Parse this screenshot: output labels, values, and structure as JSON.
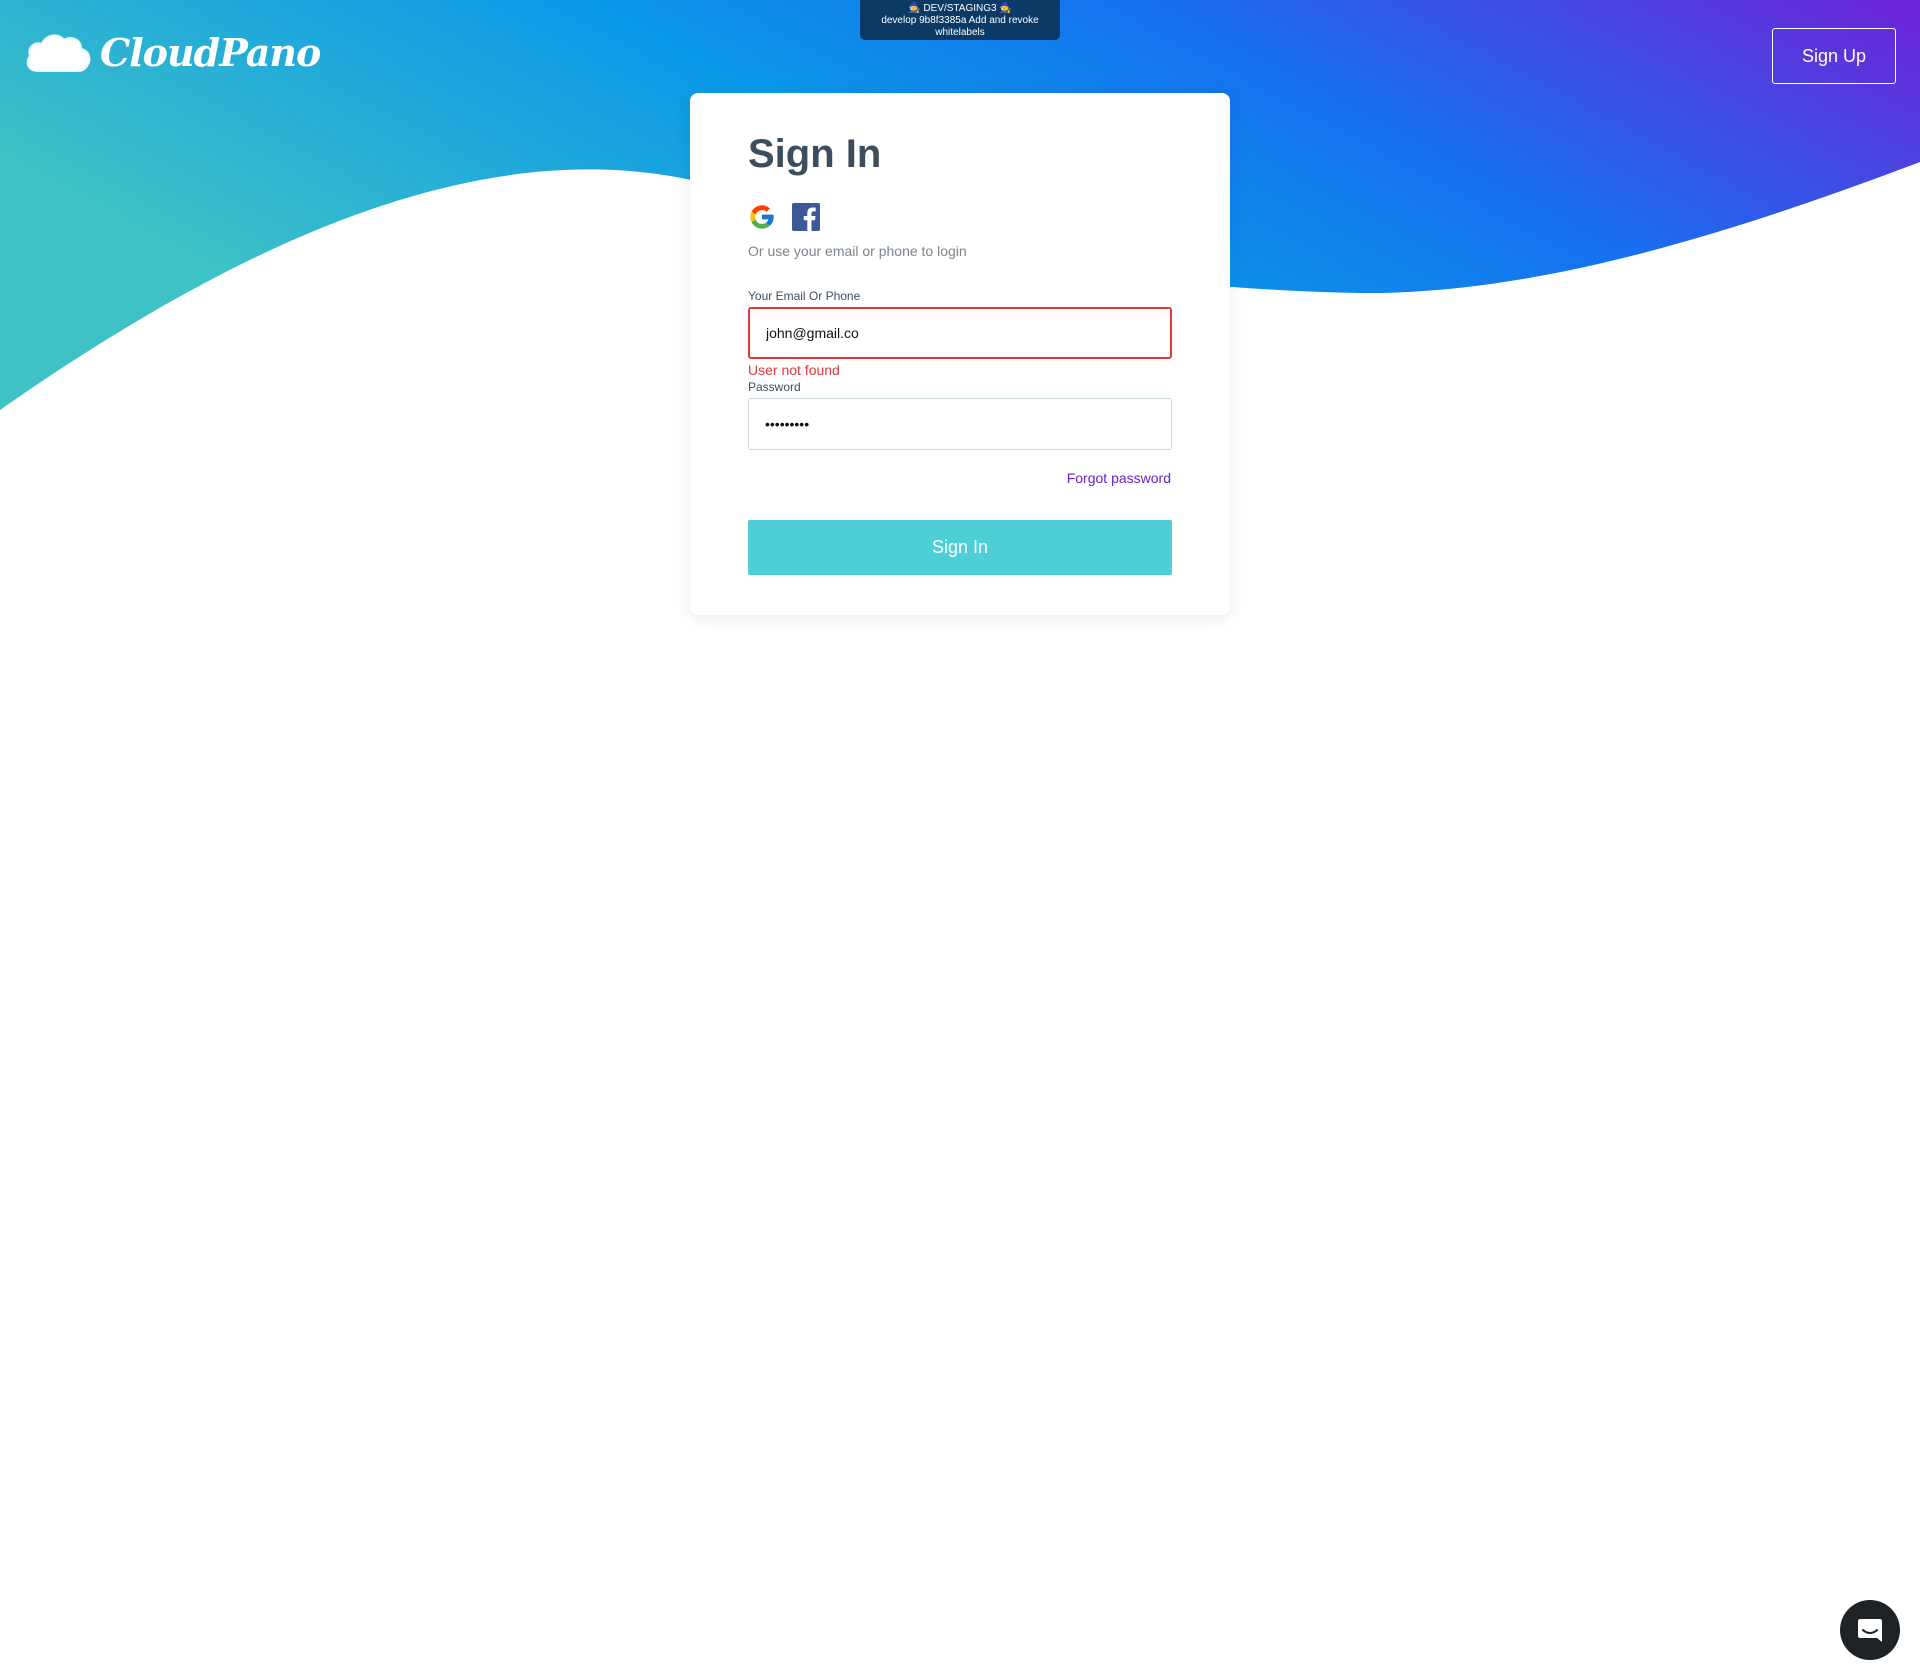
{
  "dev_banner": {
    "line1": "🧙 DEV/STAGING3 🧙",
    "line2": "develop 9b8f3385a Add and revoke",
    "line3": "whitelabels"
  },
  "header": {
    "logo_text": "CloudPano",
    "signup_label": "Sign Up"
  },
  "signin": {
    "title": "Sign In",
    "alt_login_text": "Or use your email or phone to login",
    "email_label": "Your Email Or Phone",
    "email_value": "john@gmail.co",
    "email_error": "User not found",
    "password_label": "Password",
    "password_value": "passwordx",
    "forgot_label": "Forgot password",
    "submit_label": "Sign In"
  },
  "icons": {
    "google": "google-icon",
    "facebook": "facebook-icon",
    "chat": "chat-icon",
    "cloud": "cloud-logo-icon"
  },
  "colors": {
    "gradient_start": "#3fc2c6",
    "gradient_mid": "#0a98e8",
    "gradient_end": "#6f23d8",
    "error": "#e03a3a",
    "link": "#6a1ecf",
    "primary_button": "#4ecfd8",
    "title_text": "#3c4e5e"
  }
}
